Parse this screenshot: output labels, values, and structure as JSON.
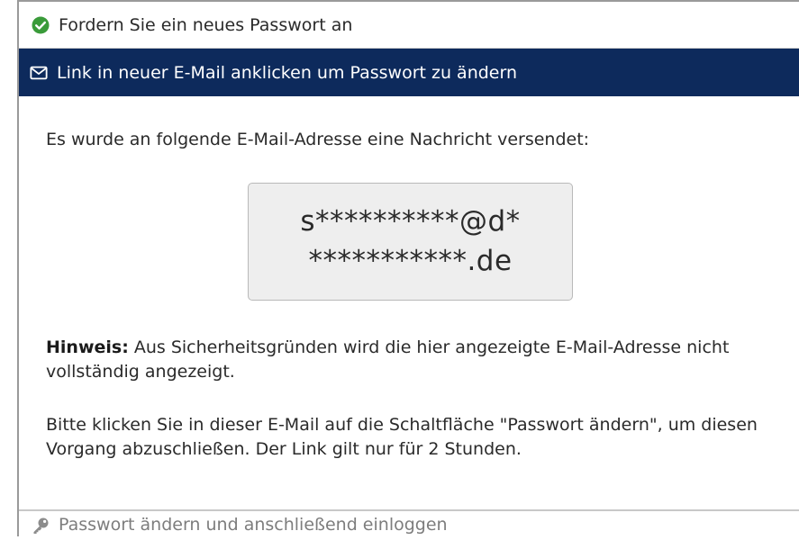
{
  "steps": {
    "done": {
      "label": "Fordern Sie ein neues Passwort an",
      "icon": "check-circle-icon",
      "icon_color": "#3a9b3a"
    },
    "active": {
      "label": "Link in neuer E-Mail anklicken um Passwort zu ändern",
      "icon": "envelope-icon",
      "background": "#0d2a5c"
    },
    "pending": {
      "label": "Passwort ändern und anschließend einloggen",
      "icon": "key-icon",
      "text_color": "#7d7d7d"
    }
  },
  "content": {
    "intro": "Es wurde an folgende E-Mail-Adresse eine Nachricht versendet:",
    "email_line1": "s**********@d*",
    "email_line2": "***********.de",
    "note_label": "Hinweis:",
    "note_text": " Aus Sicherheitsgründen wird die hier angezeigte E-Mail-Adresse nicht vollständig angezeigt.",
    "instruction": "Bitte klicken Sie in dieser E-Mail auf die Schaltfläche \"Passwort ändern\", um diesen Vorgang abzuschließen. Der Link gilt nur für 2 Stunden."
  }
}
